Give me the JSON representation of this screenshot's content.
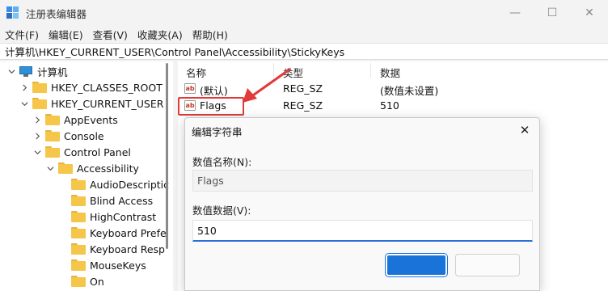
{
  "window": {
    "title": "注册表编辑器",
    "minimize_glyph": "—",
    "maximize_glyph": "☐",
    "close_glyph": "✕"
  },
  "menu": [
    "文件(F)",
    "编辑(E)",
    "查看(V)",
    "收藏夹(A)",
    "帮助(H)"
  ],
  "address": "计算机\\HKEY_CURRENT_USER\\Control Panel\\Accessibility\\StickyKeys",
  "tree": [
    {
      "label": "计算机",
      "expanded": true,
      "icon": "computer-icon"
    },
    {
      "label": "HKEY_CLASSES_ROOT",
      "expanded": false,
      "icon": "folder-icon"
    },
    {
      "label": "HKEY_CURRENT_USER",
      "expanded": true,
      "icon": "folder-icon"
    },
    {
      "label": "AppEvents",
      "expanded": false,
      "icon": "folder-icon"
    },
    {
      "label": "Console",
      "expanded": false,
      "icon": "folder-icon"
    },
    {
      "label": "Control Panel",
      "expanded": true,
      "icon": "folder-icon"
    },
    {
      "label": "Accessibility",
      "expanded": true,
      "icon": "folder-icon"
    },
    {
      "label": "AudioDescriptic",
      "expanded": null,
      "icon": "folder-icon"
    },
    {
      "label": "Blind Access",
      "expanded": null,
      "icon": "folder-icon"
    },
    {
      "label": "HighContrast",
      "expanded": null,
      "icon": "folder-icon"
    },
    {
      "label": "Keyboard Prefe",
      "expanded": null,
      "icon": "folder-icon"
    },
    {
      "label": "Keyboard Resp",
      "expanded": null,
      "icon": "folder-icon"
    },
    {
      "label": "MouseKeys",
      "expanded": null,
      "icon": "folder-icon"
    },
    {
      "label": "On",
      "expanded": null,
      "icon": "folder-icon"
    }
  ],
  "list": {
    "headers": [
      "名称",
      "类型",
      "数据"
    ],
    "rows": [
      {
        "name": "(默认)",
        "type": "REG_SZ",
        "data": "(数值未设置)",
        "icon": "string-value-icon"
      },
      {
        "name": "Flags",
        "type": "REG_SZ",
        "data": "510",
        "icon": "string-value-icon"
      }
    ],
    "icon_glyph": "ab"
  },
  "dialog": {
    "title": "编辑字符串",
    "close_glyph": "✕",
    "name_label": "数值名称(N):",
    "name_value": "Flags",
    "data_label": "数值数据(V):",
    "data_value": "510"
  },
  "colors": {
    "accent": "#1a73d9",
    "highlight": "#e23a3a",
    "folder": "#f6c64a"
  }
}
